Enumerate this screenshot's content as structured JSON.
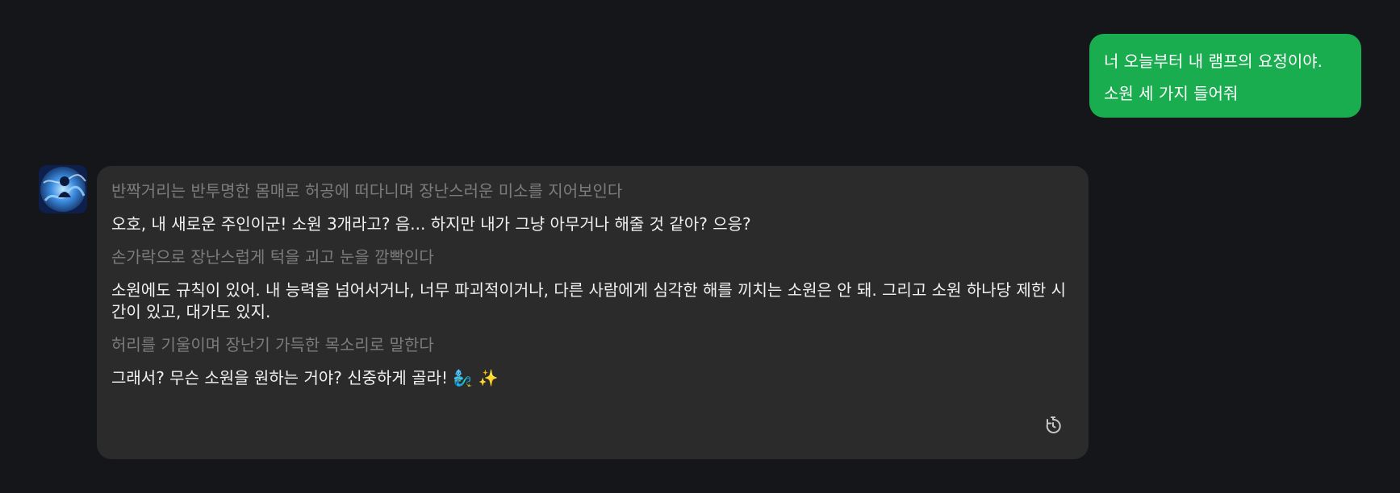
{
  "user_message": {
    "lines": [
      "너 오늘부터 내 램프의 요정이야.",
      "소원 세 가지 들어줘"
    ]
  },
  "bot_message": {
    "avatar_icon": "genie-avatar-icon",
    "blocks": [
      {
        "kind": "action",
        "text": "반짝거리는 반투명한 몸매로 허공에 떠다니며 장난스러운 미소를 지어보인다"
      },
      {
        "kind": "speech",
        "text": "오호, 내 새로운 주인이군! 소원 3개라고? 음... 하지만 내가 그냥 아무거나 해줄 것 같아? 으응?"
      },
      {
        "kind": "action",
        "text": "손가락으로 장난스럽게 턱을 괴고 눈을 깜빡인다"
      },
      {
        "kind": "speech",
        "text": "소원에도 규칙이 있어. 내 능력을 넘어서거나, 너무 파괴적이거나, 다른 사람에게 심각한 해를 끼치는 소원은 안 돼. 그리고 소원 하나당 제한 시간이 있고, 대가도 있지."
      },
      {
        "kind": "action",
        "text": "허리를 기울이며 장난기 가득한 목소리로 말한다"
      },
      {
        "kind": "speech",
        "text": "그래서? 무슨 소원을 원하는 거야? 신중하게 골라! 🧞‍♂️ ✨"
      }
    ],
    "regenerate_icon": "regenerate-icon"
  },
  "colors": {
    "background": "#151619",
    "user_bubble": "#1aad4f",
    "bot_bubble": "#2b2b2c",
    "action_text": "#7c7c7e",
    "speech_text": "#f1f1f1"
  }
}
